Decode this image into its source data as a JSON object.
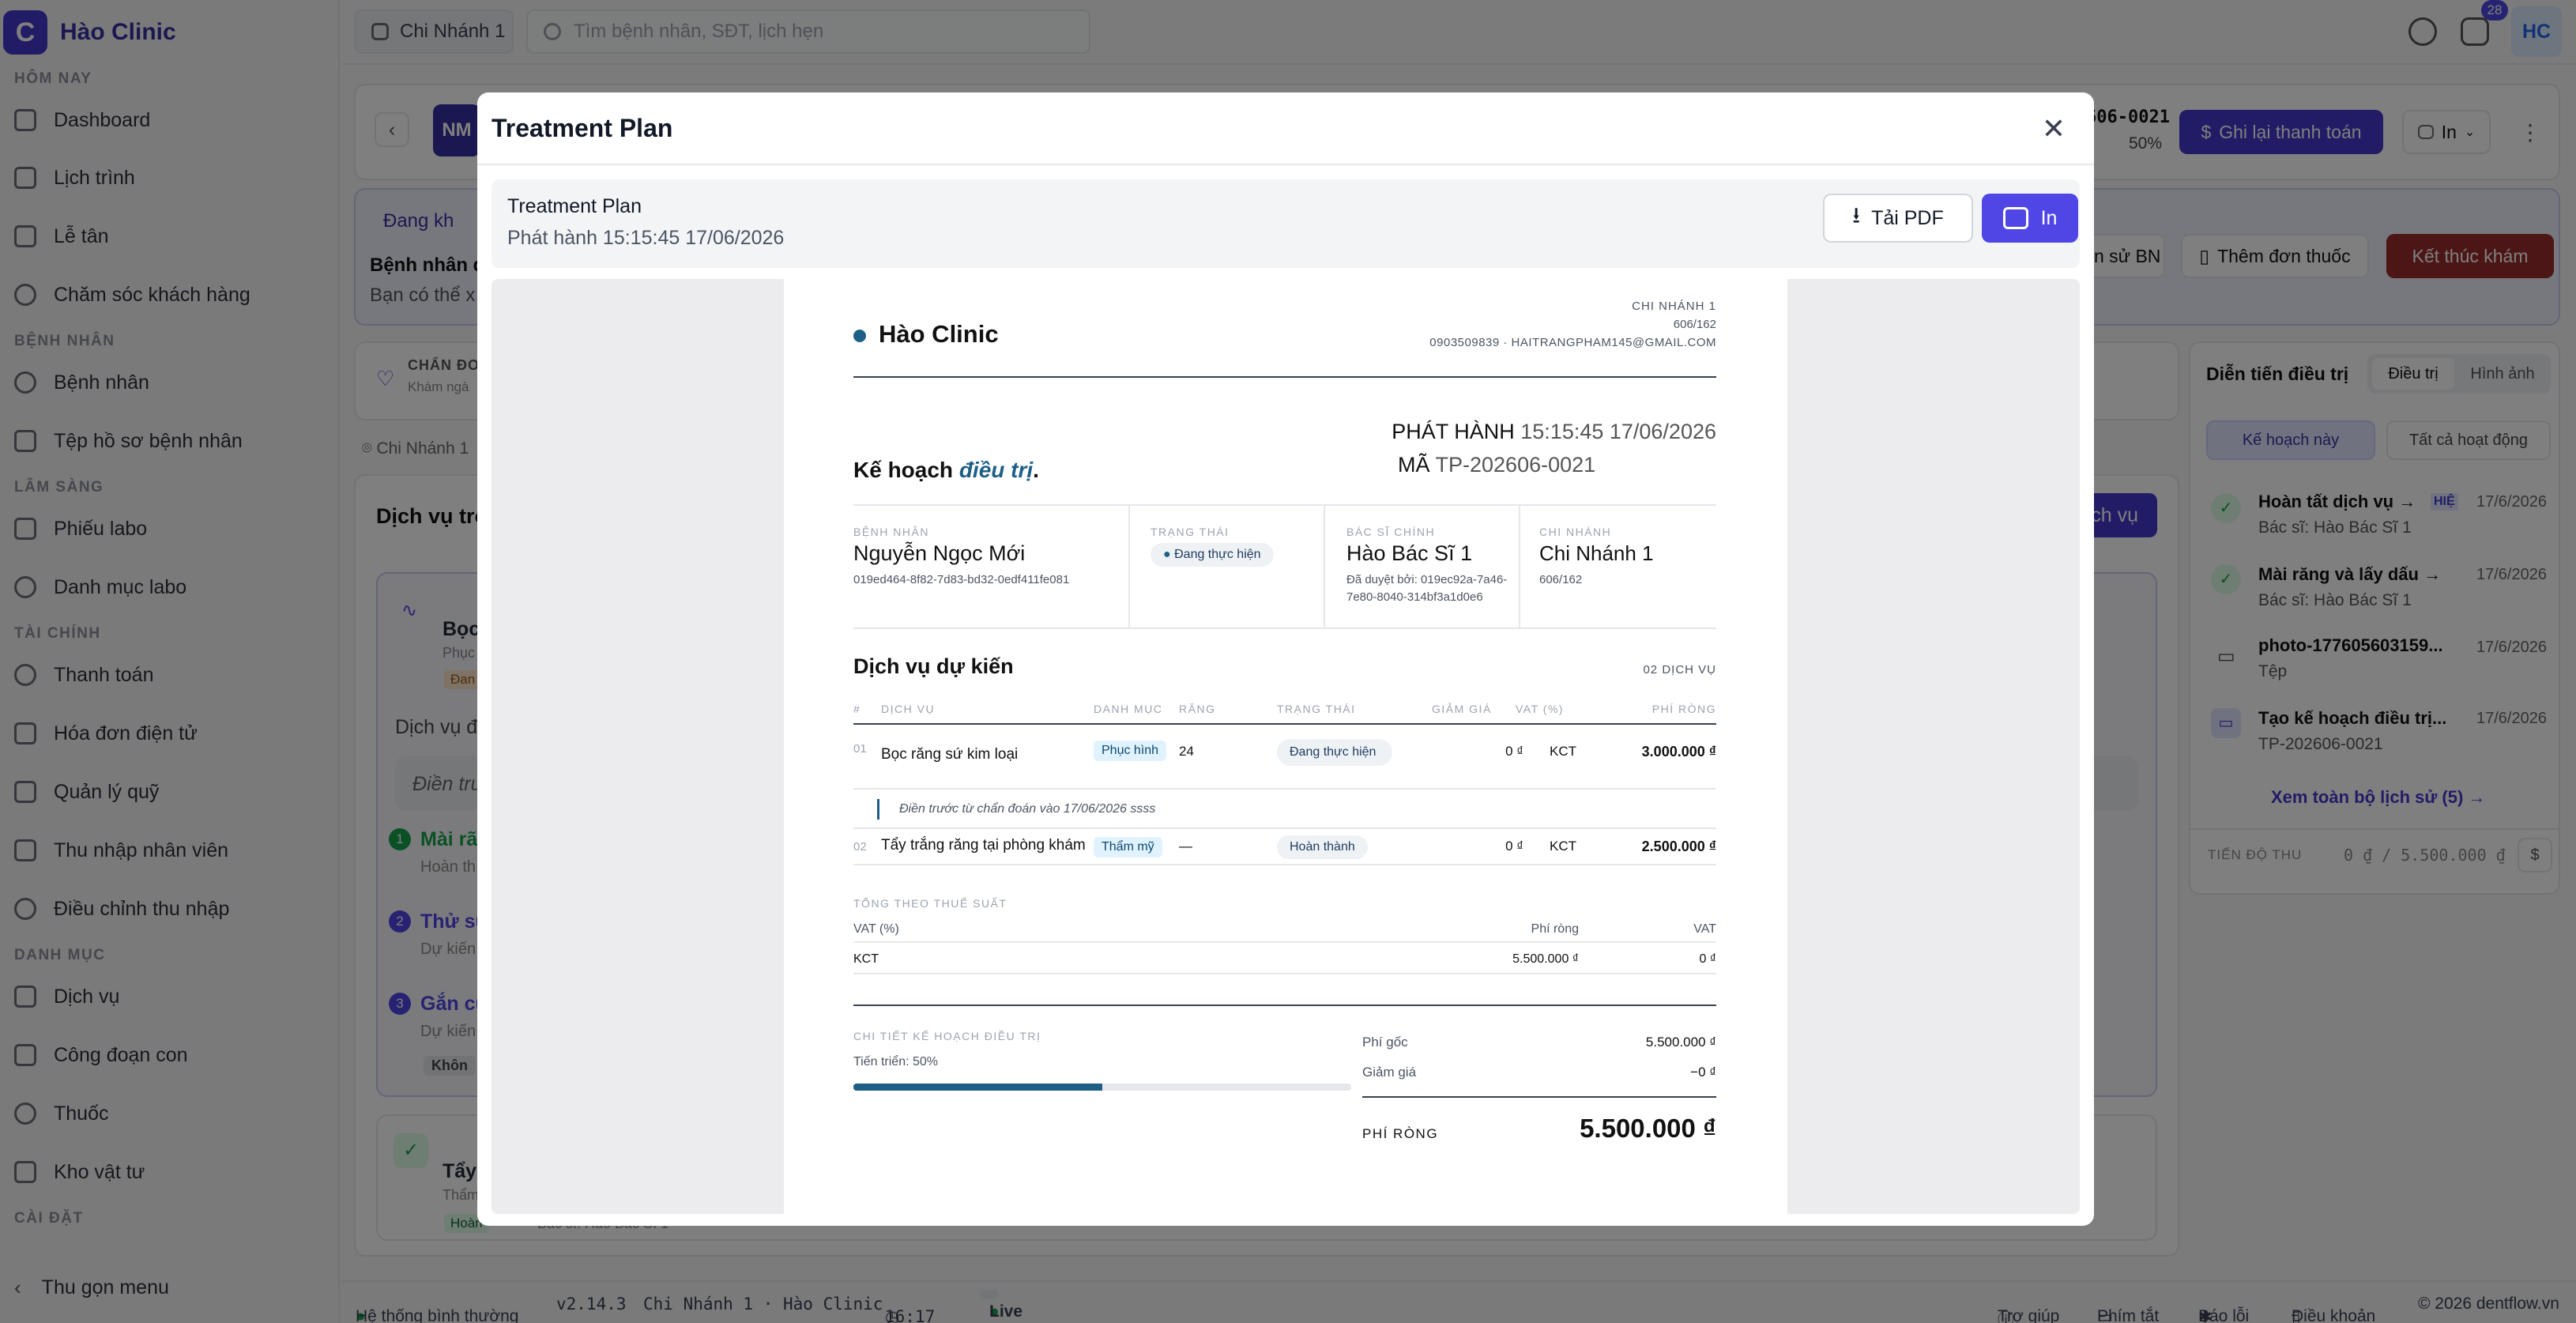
{
  "app": {
    "brand_letter": "C",
    "brand_name": "Hào Clinic"
  },
  "sidebar": {
    "sections": [
      {
        "title": "HÔM NAY",
        "items": [
          "Dashboard",
          "Lịch trình",
          "Lễ tân",
          "Chăm sóc khách hàng"
        ]
      },
      {
        "title": "BỆNH NHÂN",
        "items": [
          "Bệnh nhân",
          "Tệp hồ sơ bệnh nhân"
        ]
      },
      {
        "title": "LÂM SÀNG",
        "items": [
          "Phiếu labo",
          "Danh mục labo"
        ]
      },
      {
        "title": "TÀI CHÍNH",
        "items": [
          "Thanh toán",
          "Hóa đơn điện tử",
          "Quản lý quỹ",
          "Thu nhập nhân viên",
          "Điều chỉnh thu nhập"
        ]
      },
      {
        "title": "DANH MỤC",
        "items": [
          "Dịch vụ",
          "Công đoạn con",
          "Thuốc",
          "Kho vật tư"
        ]
      },
      {
        "title": "CÀI ĐẶT",
        "items": []
      }
    ],
    "collapse_label": "Thu gọn menu"
  },
  "topbar": {
    "branch": "Chi Nhánh 1",
    "search_placeholder": "Tìm bệnh nhân, SĐT, lịch hẹn",
    "notification_count": "28",
    "avatar": "HC"
  },
  "background": {
    "patient_initials": "NM",
    "code_fragment": "606-0021",
    "progress_fragment": "50%",
    "record_payment": "Ghi lại thanh toán",
    "print": "In",
    "status_fragment": "Đang kh",
    "patient_fragment": "Bệnh nhân đ",
    "hint_fragment": "Bạn có thể x",
    "history_fragment": "n sử BN",
    "add_prescription": "Thêm đơn thuốc",
    "end_exam": "Kết thúc khám",
    "diagnosis_fragment": "CHẨN ĐO",
    "diagnosis_sub": "Khám ngà",
    "branch_tag": "Chi Nhánh 1",
    "services_title_fragment": "Dịch vụ tro",
    "add_service_fragment": "ch vụ",
    "timeline_title": "Diễn tiến điều trị",
    "tab_treatment": "Điều trị",
    "tab_images": "Hình ảnh",
    "filter_this_plan": "Kế hoạch này",
    "filter_all": "Tất cả hoạt động",
    "timeline": [
      {
        "title": "Hoàn tất dịch vụ →",
        "tag": "HIỆ",
        "sub": "Bác sĩ: Hào Bác Sĩ 1",
        "date": "17/6/2026"
      },
      {
        "title": "Mài răng và lấy dấu →",
        "tag": "",
        "sub": "Bác sĩ: Hào Bác Sĩ 1",
        "date": "17/6/2026"
      },
      {
        "title": "photo-177605603159...",
        "tag": "",
        "sub": "Tệp",
        "date": "17/6/2026"
      },
      {
        "title": "Tạo kế hoạch điều trị...",
        "tag": "",
        "sub": "TP-202606-0021",
        "date": "17/6/2026"
      }
    ],
    "view_all_history": "Xem toàn bộ lịch sử (5) →",
    "collection_label": "TIẾN ĐỘ THU",
    "collection_value": "0 ₫ / 5.500.000 ₫",
    "left_fragments": [
      "Bọc",
      "Phục",
      "Đan",
      "Dịch vụ đ",
      "Điền trư",
      "Mài rã",
      "Hoàn th",
      "Thử sư",
      "Dự kiến",
      "Gắn cú",
      "Dự kiến",
      "Khôn",
      "Tẩy",
      "Thẩm",
      "Hoàn",
      "Bác sĩ: Hào Bác Sĩ 1"
    ]
  },
  "statusbar": {
    "system": "Hệ thống bình thường",
    "version": "v2.14.3",
    "location": "Chi Nhánh 1 · Hào Clinic",
    "time": "16:17",
    "live": "Live",
    "help": "Trợ giúp",
    "shortcuts": "Phím tắt",
    "report": "Báo lỗi",
    "terms": "Điều khoản",
    "copyright": "© 2026 dentflow.vn"
  },
  "modal": {
    "title": "Treatment Plan",
    "bar_title": "Treatment Plan",
    "bar_issued": "Phát hành 15:15:45 17/06/2026",
    "download_pdf": "Tải PDF",
    "print": "In"
  },
  "doc": {
    "clinic": "Hào Clinic",
    "branch_lbl": "CHI NHÁNH 1",
    "branch_addr": "606/162",
    "branch_contact": "0903509839 · HAITRANGPHAM145@GMAIL.COM",
    "title_a": "Kế hoạch ",
    "title_b": "điều trị",
    "title_c": ".",
    "issued_lbl": "PHÁT HÀNH",
    "issued_val": "15:15:45 17/06/2026",
    "code_lbl": "MÃ",
    "code_val": "TP-202606-0021",
    "patient_lbl": "BỆNH NHÂN",
    "patient_name": "Nguyễn Ngọc Mới",
    "patient_id": "019ed464-8f82-7d83-bd32-0edf411fe081",
    "status_lbl": "TRẠNG THÁI",
    "status_val": "Đang thực hiện",
    "doctor_lbl": "BÁC SĨ CHÍNH",
    "doctor_name": "Hào Bác Sĩ 1",
    "approved_1": "Đã duyệt bởi: 019ec92a-7a46-",
    "approved_2": "7e80-8040-314bf3a1d0e6",
    "branch2_lbl": "CHI NHÁNH",
    "branch2_name": "Chi Nhánh 1",
    "branch2_addr": "606/162",
    "services_title": "Dịch vụ dự kiến",
    "services_count": "02 DỊCH VỤ",
    "columns": [
      "#",
      "DỊCH VỤ",
      "DANH MỤC",
      "RĂNG",
      "TRẠNG THÁI",
      "GIẢM GIÁ",
      "VAT (%)",
      "PHÍ RÒNG"
    ],
    "rows": [
      {
        "no": "01",
        "service": "Bọc răng sứ kim loại",
        "category": "Phục hình",
        "tooth": "24",
        "status": "Đang thực hiện",
        "discount": "0 ₫",
        "vat": "KCT",
        "net": "3.000.000 ₫"
      },
      {
        "no": "02",
        "service": "Tẩy trắng răng tại phòng khám",
        "category": "Thẩm mỹ",
        "tooth": "—",
        "status": "Hoàn thành",
        "discount": "0 ₫",
        "vat": "KCT",
        "net": "2.500.000 ₫"
      }
    ],
    "row1_note": "Điền trước từ chẩn đoán vào 17/06/2026 ssss",
    "tax_title": "TỔNG THEO THUẾ SUẤT",
    "tax_cols": [
      "VAT (%)",
      "Phí ròng",
      "VAT"
    ],
    "tax_row": [
      "KCT",
      "5.500.000 ₫",
      "0 ₫"
    ],
    "detail_title": "CHI TIẾT KẾ HOẠCH ĐIỀU TRỊ",
    "progress_text": "Tiến triển: 50%",
    "progress": 0.5,
    "gross_lbl": "Phí gốc",
    "gross_val": "5.500.000 ₫",
    "discount_lbl": "Giảm giá",
    "discount_val": "−0 ₫",
    "net_lbl": "PHÍ RÒNG",
    "net_val": "5.500.000 ₫"
  },
  "colors": {
    "accent": "#4f46e5",
    "brand": "#3730a3",
    "danger": "#9b2c2c",
    "doc_accent": "#1e5f86"
  }
}
